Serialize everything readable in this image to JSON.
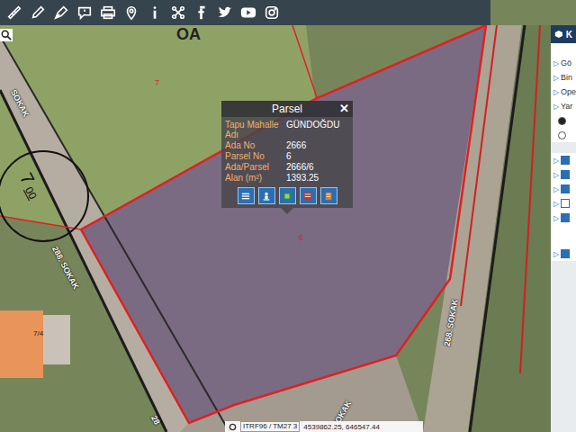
{
  "map_labels": [
    {
      "text": "OA",
      "kind": "block"
    },
    {
      "text": "7",
      "kind": "parcel"
    },
    {
      "text": "6",
      "kind": "parcel"
    },
    {
      "text": "7/4",
      "kind": "building"
    },
    {
      "text": "SOKAK",
      "kind": "street"
    },
    {
      "text": "288. SOKAK",
      "kind": "street"
    },
    {
      "text": "288. SOKAK",
      "kind": "street"
    },
    {
      "text": "SOKAK",
      "kind": "street"
    },
    {
      "text": "28",
      "kind": "street"
    }
  ],
  "height_marker": {
    "value": "7",
    "sub": "00"
  },
  "popup": {
    "title": "Parsel",
    "close": "✕",
    "rows": [
      {
        "label": "Tapu Mahalle Adı",
        "value": "GÜNDOĞDU"
      },
      {
        "label": "Ada No",
        "value": "2666"
      },
      {
        "label": "Parsel No",
        "value": "6"
      },
      {
        "label": "Ada/Parsel",
        "value": "2666/6"
      },
      {
        "label": "Alan (m²)",
        "value": "1393.25"
      }
    ]
  },
  "layer_panel": {
    "header": "K",
    "expander": "▷",
    "groups": [
      {
        "label": "Gö"
      },
      {
        "label": "Bin"
      },
      {
        "label": "Ope"
      },
      {
        "label": "Yar"
      }
    ],
    "radios": [
      {
        "selected": true
      },
      {
        "selected": false
      }
    ],
    "checks": [
      {
        "checked": true
      },
      {
        "checked": true
      },
      {
        "checked": true
      },
      {
        "checked": false
      },
      {
        "checked": true
      },
      {
        "checked": true
      }
    ]
  },
  "status_bar": {
    "projection": "ITRF96 / TM27 3",
    "coordinates": "4539862.25, 646547.44"
  }
}
